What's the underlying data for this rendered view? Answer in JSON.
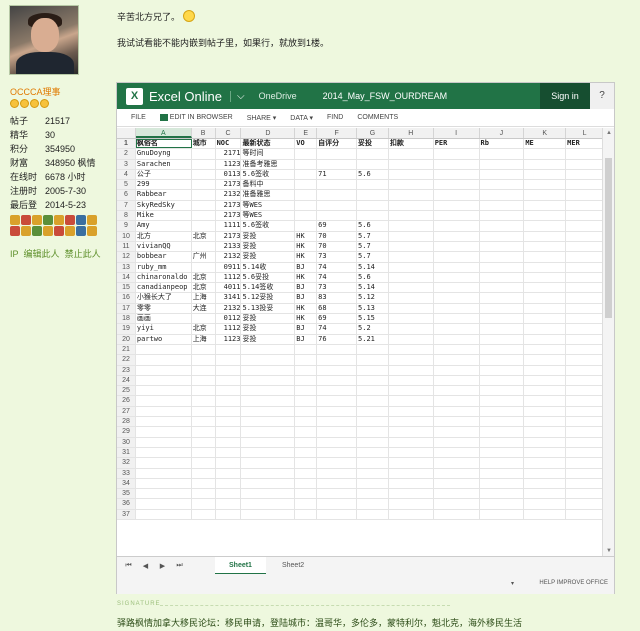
{
  "user": {
    "name": "OCCCA理事",
    "stats": [
      {
        "k": "帖子",
        "v": "21517"
      },
      {
        "k": "精华",
        "v": "30"
      },
      {
        "k": "积分",
        "v": "354950"
      },
      {
        "k": "财富",
        "v": "348950 枫情"
      },
      {
        "k": "在线时",
        "v": "6678 小时"
      },
      {
        "k": "注册时",
        "v": "2005-7-30"
      },
      {
        "k": "最后登",
        "v": "2014-5-23"
      }
    ],
    "links": {
      "ip": "IP",
      "edit": "编辑此人",
      "ban": "禁止此人"
    }
  },
  "post": {
    "line1": "辛苦北方兄了。",
    "line2": "我试试看能不能内嵌到帖子里，如果行，就放到1楼。"
  },
  "excel": {
    "app_name": "Excel Online",
    "onedrive": "OneDrive",
    "file_name": "2014_May_FSW_OURDREAM",
    "sign_in": "Sign in",
    "help": "?",
    "ribbon": [
      "FILE",
      "EDIT IN BROWSER",
      "SHARE ▾",
      "DATA ▾",
      "FIND",
      "COMMENTS"
    ],
    "columns": [
      "A",
      "B",
      "C",
      "D",
      "E",
      "F",
      "G",
      "H",
      "I",
      "J",
      "K",
      "L"
    ],
    "rows": [
      {
        "n": "1",
        "c": [
          "枫俗名",
          "城市",
          "NOC",
          "最新状态",
          "VO",
          "自评分",
          "妥投",
          "扣款",
          "PER",
          "Rb",
          "ME",
          "MER"
        ]
      },
      {
        "n": "2",
        "c": [
          "GnuDoyng",
          "",
          "2171",
          "等时间",
          "",
          "",
          "",
          "",
          "",
          "",
          "",
          ""
        ]
      },
      {
        "n": "3",
        "c": [
          "Sarachen",
          "",
          "1123",
          "准备考雅思",
          "",
          "",
          "",
          "",
          "",
          "",
          "",
          ""
        ]
      },
      {
        "n": "4",
        "c": [
          "公子",
          "",
          "0113",
          "5.6签收",
          "",
          "71",
          "5.6",
          "",
          "",
          "",
          "",
          ""
        ]
      },
      {
        "n": "5",
        "c": [
          "299",
          "",
          "2173",
          "备料中",
          "",
          "",
          "",
          "",
          "",
          "",
          "",
          ""
        ]
      },
      {
        "n": "6",
        "c": [
          "Rabbear",
          "",
          "2132",
          "准备雅思",
          "",
          "",
          "",
          "",
          "",
          "",
          "",
          ""
        ]
      },
      {
        "n": "7",
        "c": [
          "SkyRedSky",
          "",
          "2173",
          "等WES",
          "",
          "",
          "",
          "",
          "",
          "",
          "",
          ""
        ]
      },
      {
        "n": "8",
        "c": [
          "Mike",
          "",
          "2173",
          "等WES",
          "",
          "",
          "",
          "",
          "",
          "",
          "",
          ""
        ]
      },
      {
        "n": "9",
        "c": [
          "Amy",
          "",
          "1111",
          "5.6签收",
          "",
          "69",
          "5.6",
          "",
          "",
          "",
          "",
          ""
        ]
      },
      {
        "n": "10",
        "c": [
          "北方",
          "北京",
          "2173",
          "妥投",
          "HK",
          "70",
          "5.7",
          "",
          "",
          "",
          "",
          ""
        ]
      },
      {
        "n": "11",
        "c": [
          "vivianQQ",
          "",
          "2133",
          "妥投",
          "HK",
          "70",
          "5.7",
          "",
          "",
          "",
          "",
          ""
        ]
      },
      {
        "n": "12",
        "c": [
          "bobbear",
          "广州",
          "2132",
          "妥投",
          "HK",
          "73",
          "5.7",
          "",
          "",
          "",
          "",
          ""
        ]
      },
      {
        "n": "13",
        "c": [
          "ruby_mm",
          "",
          "0911",
          "5.14收",
          "BJ",
          "74",
          "5.14",
          "",
          "",
          "",
          "",
          ""
        ]
      },
      {
        "n": "14",
        "c": [
          "chinaronaldo",
          "北京",
          "1112",
          "5.6妥投",
          "HK",
          "74",
          "5.6",
          "",
          "",
          "",
          "",
          ""
        ]
      },
      {
        "n": "15",
        "c": [
          "canadianpeop",
          "北京",
          "4011",
          "5.14签收",
          "BJ",
          "73",
          "5.14",
          "",
          "",
          "",
          "",
          ""
        ]
      },
      {
        "n": "16",
        "c": [
          "小猴长大了",
          "上海",
          "3141",
          "5.12妥投",
          "BJ",
          "83",
          "5.12",
          "",
          "",
          "",
          "",
          ""
        ]
      },
      {
        "n": "17",
        "c": [
          "零零",
          "大连",
          "2132",
          "5.13投妥",
          "HK",
          "68",
          "5.13",
          "",
          "",
          "",
          "",
          ""
        ]
      },
      {
        "n": "18",
        "c": [
          "画画",
          "",
          "0112",
          "妥投",
          "HK",
          "69",
          "5.15",
          "",
          "",
          "",
          "",
          ""
        ]
      },
      {
        "n": "19",
        "c": [
          "yiyi",
          "北京",
          "1112",
          "妥投",
          "BJ",
          "74",
          "5.2",
          "",
          "",
          "",
          "",
          ""
        ]
      },
      {
        "n": "20",
        "c": [
          "partwo",
          "上海",
          "1123",
          "妥投",
          "BJ",
          "76",
          "5.21",
          "",
          "",
          "",
          "",
          ""
        ]
      },
      {
        "n": "21",
        "c": [
          "",
          "",
          "",
          "",
          "",
          "",
          "",
          "",
          "",
          "",
          "",
          ""
        ]
      },
      {
        "n": "22",
        "c": [
          "",
          "",
          "",
          "",
          "",
          "",
          "",
          "",
          "",
          "",
          "",
          ""
        ]
      },
      {
        "n": "23",
        "c": [
          "",
          "",
          "",
          "",
          "",
          "",
          "",
          "",
          "",
          "",
          "",
          ""
        ]
      },
      {
        "n": "24",
        "c": [
          "",
          "",
          "",
          "",
          "",
          "",
          "",
          "",
          "",
          "",
          "",
          ""
        ]
      },
      {
        "n": "25",
        "c": [
          "",
          "",
          "",
          "",
          "",
          "",
          "",
          "",
          "",
          "",
          "",
          ""
        ]
      },
      {
        "n": "26",
        "c": [
          "",
          "",
          "",
          "",
          "",
          "",
          "",
          "",
          "",
          "",
          "",
          ""
        ]
      },
      {
        "n": "27",
        "c": [
          "",
          "",
          "",
          "",
          "",
          "",
          "",
          "",
          "",
          "",
          "",
          ""
        ]
      },
      {
        "n": "28",
        "c": [
          "",
          "",
          "",
          "",
          "",
          "",
          "",
          "",
          "",
          "",
          "",
          ""
        ]
      },
      {
        "n": "29",
        "c": [
          "",
          "",
          "",
          "",
          "",
          "",
          "",
          "",
          "",
          "",
          "",
          ""
        ]
      },
      {
        "n": "30",
        "c": [
          "",
          "",
          "",
          "",
          "",
          "",
          "",
          "",
          "",
          "",
          "",
          ""
        ]
      },
      {
        "n": "31",
        "c": [
          "",
          "",
          "",
          "",
          "",
          "",
          "",
          "",
          "",
          "",
          "",
          ""
        ]
      },
      {
        "n": "32",
        "c": [
          "",
          "",
          "",
          "",
          "",
          "",
          "",
          "",
          "",
          "",
          "",
          ""
        ]
      },
      {
        "n": "33",
        "c": [
          "",
          "",
          "",
          "",
          "",
          "",
          "",
          "",
          "",
          "",
          "",
          ""
        ]
      },
      {
        "n": "34",
        "c": [
          "",
          "",
          "",
          "",
          "",
          "",
          "",
          "",
          "",
          "",
          "",
          ""
        ]
      },
      {
        "n": "35",
        "c": [
          "",
          "",
          "",
          "",
          "",
          "",
          "",
          "",
          "",
          "",
          "",
          ""
        ]
      },
      {
        "n": "36",
        "c": [
          "",
          "",
          "",
          "",
          "",
          "",
          "",
          "",
          "",
          "",
          "",
          ""
        ]
      },
      {
        "n": "37",
        "c": [
          "",
          "",
          "",
          "",
          "",
          "",
          "",
          "",
          "",
          "",
          "",
          ""
        ]
      }
    ],
    "sheets": [
      "Sheet1",
      "Sheet2"
    ],
    "active_sheet": "Sheet1",
    "status_right": "HELP IMPROVE OFFICE"
  },
  "signature": {
    "label": "SIGNATURE",
    "text": "驿路枫情加拿大移民论坛：移民申请，登陆城市：温哥华，多伦多，蒙特利尔，魁北克，海外移民生活"
  }
}
